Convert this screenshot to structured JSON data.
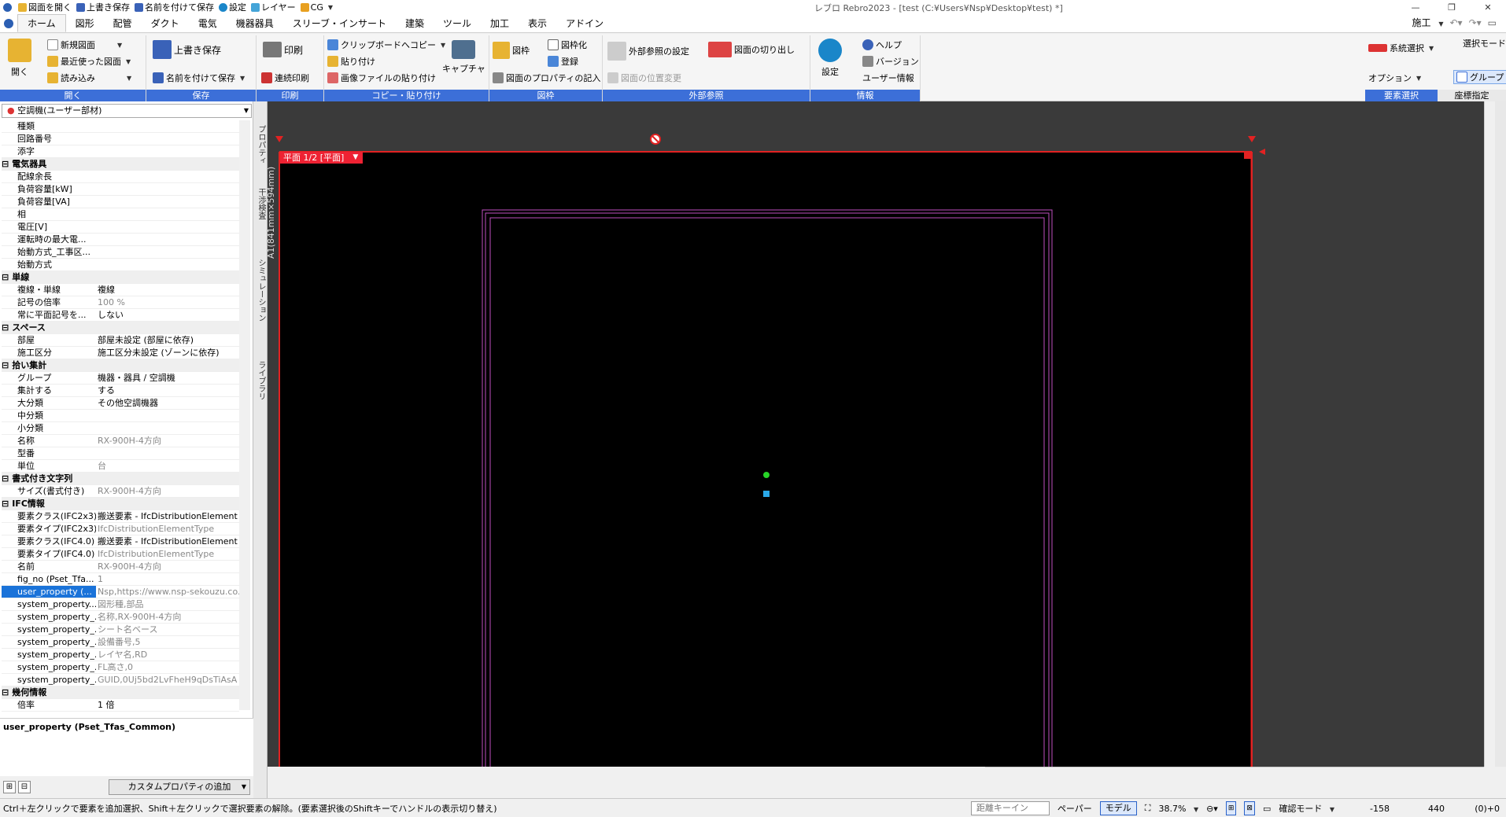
{
  "app": {
    "title": "レブロ Rebro2023 - [test (C:¥Users¥Nsp¥Desktop¥test) *]"
  },
  "quick_access": [
    {
      "label": "図面を開く",
      "icon": "folder-open-icon"
    },
    {
      "label": "上書き保存",
      "icon": "save-icon"
    },
    {
      "label": "名前を付けて保存",
      "icon": "save-as-icon"
    },
    {
      "label": "設定",
      "icon": "gear-icon"
    },
    {
      "label": "レイヤー",
      "icon": "layer-icon"
    },
    {
      "label": "CG",
      "icon": "cg-icon"
    }
  ],
  "menu_tabs": [
    "ホーム",
    "図形",
    "配管",
    "ダクト",
    "電気",
    "機器器具",
    "スリーブ・インサート",
    "建築",
    "ツール",
    "加工",
    "表示",
    "アドイン"
  ],
  "menu_right": {
    "mode": "施工"
  },
  "ribbon": {
    "open": {
      "label": "開く",
      "group": "開く",
      "items": [
        "新規図面",
        "最近使った図面",
        "読み込み"
      ]
    },
    "save": {
      "group": "保存",
      "overwrite": "上書き保存",
      "save_as": "名前を付けて保存"
    },
    "print": {
      "group": "印刷",
      "print": "印刷",
      "continuous": "連続印刷"
    },
    "copy": {
      "group": "コピー・貼り付け",
      "items": [
        "クリップボードへコピー",
        "貼り付け",
        "画像ファイルの貼り付け"
      ],
      "capture": "キャプチャ"
    },
    "frame": {
      "group": "図枠",
      "frame": "図枠",
      "frameize": "図枠化",
      "register": "登録",
      "props": "図面のプロパティの記入"
    },
    "external": {
      "group": "外部参照",
      "settings": "外部参照の設定",
      "cutout": "図面の切り出し",
      "position": "図面の位置変更"
    },
    "info": {
      "group": "情報",
      "settings": "設定",
      "help": "ヘルプ",
      "version": "バージョン",
      "user": "ユーザー情報"
    },
    "right": {
      "system_select": "系統選択",
      "select_mode": "選択モード",
      "option": "オプション",
      "group_btn": "グループ",
      "element_select": "要素選択",
      "coord": "座標指定"
    }
  },
  "element_select": "空調機(ユーザー部材)",
  "properties": [
    {
      "k": "種類",
      "v": ""
    },
    {
      "k": "回路番号",
      "v": ""
    },
    {
      "k": " 添字",
      "v": ""
    },
    {
      "cat": "電気器具"
    },
    {
      "k": "配線余長",
      "v": ""
    },
    {
      "k": "負荷容量[kW]",
      "v": ""
    },
    {
      "k": "負荷容量[VA]",
      "v": ""
    },
    {
      "k": "相",
      "v": ""
    },
    {
      "k": "電圧[V]",
      "v": ""
    },
    {
      "k": "運転時の最大電...",
      "v": ""
    },
    {
      "k": "始動方式_工事区...",
      "v": ""
    },
    {
      "k": "始動方式",
      "v": ""
    },
    {
      "cat": "単線"
    },
    {
      "k": "複線・単線",
      "v": "複線"
    },
    {
      "k": "記号の倍率",
      "v": "100 %",
      "grey": true
    },
    {
      "k": "常に平面記号を...",
      "v": "しない"
    },
    {
      "cat": "スペース"
    },
    {
      "k": "部屋",
      "v": "部屋未設定 (部屋に依存)"
    },
    {
      "k": "施工区分",
      "v": "施工区分未設定 (ゾーンに依存)"
    },
    {
      "cat": "拾い集計"
    },
    {
      "k": "グループ",
      "v": "機器・器具 / 空調機"
    },
    {
      "k": "集計する",
      "v": "する"
    },
    {
      "k": "大分類",
      "v": "その他空調機器"
    },
    {
      "k": "中分類",
      "v": ""
    },
    {
      "k": "小分類",
      "v": ""
    },
    {
      "k": "名称",
      "v": "RX-900H-4方向",
      "grey": true
    },
    {
      "k": "型番",
      "v": ""
    },
    {
      "k": "単位",
      "v": "台",
      "grey": true
    },
    {
      "cat": "書式付き文字列"
    },
    {
      "k": "サイズ(書式付き)",
      "v": "RX-900H-4方向",
      "grey": true
    },
    {
      "cat": "IFC情報"
    },
    {
      "k": "要素クラス(IFC2x3)",
      "v": "搬送要素 - IfcDistributionElement"
    },
    {
      "k": "要素タイプ(IFC2x3)",
      "v": "IfcDistributionElementType",
      "grey": true
    },
    {
      "k": "要素クラス(IFC4.0)",
      "v": "搬送要素 - IfcDistributionElement"
    },
    {
      "k": "要素タイプ(IFC4.0)",
      "v": "IfcDistributionElementType",
      "grey": true
    },
    {
      "k": "名前",
      "v": "RX-900H-4方向",
      "grey": true
    },
    {
      "k": "fig_no (Pset_Tfa...",
      "v": "1",
      "grey": true
    },
    {
      "k": "user_property (...",
      "v": "Nsp,https://www.nsp-sekouzu.co...",
      "grey": true,
      "sel": true
    },
    {
      "k": "system_property...",
      "v": "図形種,部品",
      "grey": true
    },
    {
      "k": "system_property_...",
      "v": "名称,RX-900H-4方向",
      "grey": true
    },
    {
      "k": "system_property_...",
      "v": "シート名ベース",
      "grey": true
    },
    {
      "k": "system_property_...",
      "v": "設備番号,5",
      "grey": true
    },
    {
      "k": "system_property_...",
      "v": "レイヤ名,RD",
      "grey": true
    },
    {
      "k": "system_property_...",
      "v": "FL高さ,0",
      "grey": true
    },
    {
      "k": "system_property_...",
      "v": "GUID,0Uj5bd2LvFheH9qDsTiAsA",
      "grey": true
    },
    {
      "cat": "幾何情報"
    },
    {
      "k": "倍率",
      "v": "1 倍"
    }
  ],
  "description": "user_property (Pset_Tfas_Common)",
  "custom_prop_button": "カスタムプロパティの追加",
  "side_tabs": [
    "プロパティ",
    "干渉検査",
    "シミュレーション",
    "ライブラリ"
  ],
  "canvas": {
    "sheet_tag": "平面 1/2 [平面]",
    "paper_size": "A1(841mm×594mm)"
  },
  "status": {
    "message": "Ctrl＋左クリックで要素を追加選択、Shift＋左クリックで選択要素の解除。(要素選択後のShiftキーでハンドルの表示切り替え)",
    "distance_key": "距離キーイン",
    "paper": "ペーパー",
    "model": "モデル",
    "zoom": "38.7%",
    "confirm_mode": "確認モード",
    "x": "-158",
    "y": "440",
    "z": "(0)+0"
  },
  "colors": {
    "accent": "#3c6fd8",
    "canvas_bg": "#000000",
    "frame_red": "#e22222",
    "inner_magenta": "#c04fc0"
  }
}
